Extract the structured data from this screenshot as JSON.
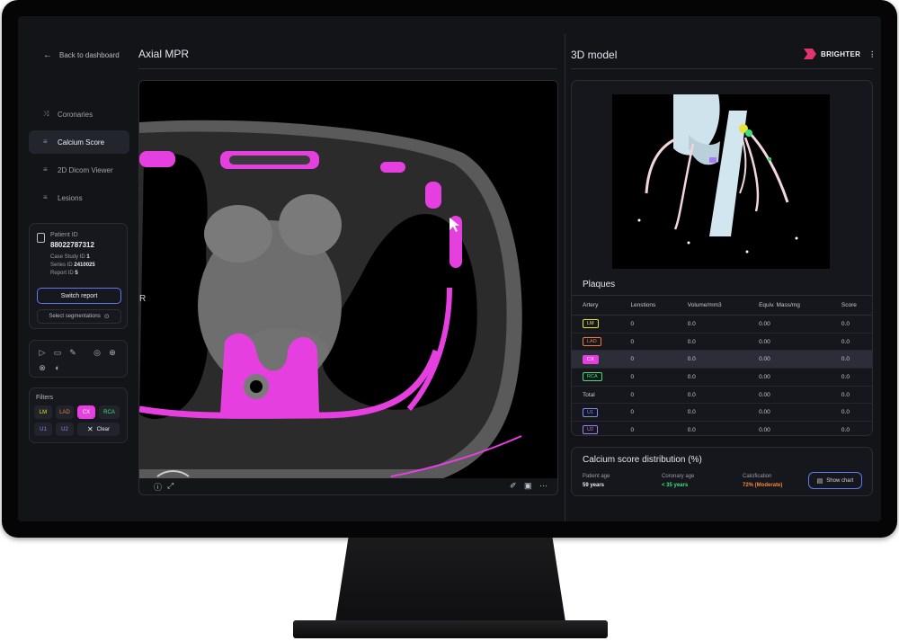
{
  "sidebar": {
    "back_label": "Back to dashboard",
    "nav": [
      {
        "label": "Coronaries",
        "icon": "shuffle-icon"
      },
      {
        "label": "Calcium Score",
        "icon": "sliders-icon"
      },
      {
        "label": "2D Dicom Viewer",
        "icon": "sliders-icon"
      },
      {
        "label": "Lesions",
        "icon": "sliders-icon"
      }
    ],
    "patient": {
      "id_label": "Patient ID",
      "id_value": "88022787312",
      "case_label": "Case Study ID",
      "case_value": "1",
      "series_label": "Series ID",
      "series_value": "2410025",
      "report_label": "Report ID",
      "report_value": "5",
      "switch_label": "Switch report",
      "select_label": "Select segmentations"
    },
    "filters": {
      "title": "Filters",
      "chips": [
        "LM",
        "LAD",
        "CX",
        "RCA",
        "U1",
        "U2"
      ],
      "clear_label": "Clear"
    }
  },
  "axial": {
    "title": "Axial MPR",
    "marker": "R"
  },
  "model": {
    "title": "3D model",
    "brand": "BRIGHTER",
    "plaques_title": "Plaques",
    "columns": [
      "Artery",
      "Lenstions",
      "Volume/mm3",
      "Equiv. Mass/mg",
      "Score"
    ],
    "rows": [
      {
        "artery": "LM",
        "lesions": "0",
        "volume": "0.0",
        "mass": "0.00",
        "score": "0.0"
      },
      {
        "artery": "LAD",
        "lesions": "0",
        "volume": "0.0",
        "mass": "0.00",
        "score": "0.0"
      },
      {
        "artery": "CX",
        "lesions": "0",
        "volume": "0.0",
        "mass": "0.00",
        "score": "0.0"
      },
      {
        "artery": "RCA",
        "lesions": "0",
        "volume": "0.0",
        "mass": "0.00",
        "score": "0.0"
      },
      {
        "artery": "Total",
        "lesions": "0",
        "volume": "0.0",
        "mass": "0.00",
        "score": "0.0"
      },
      {
        "artery": "U1",
        "lesions": "0",
        "volume": "0.0",
        "mass": "0.00",
        "score": "0.0"
      },
      {
        "artery": "U2",
        "lesions": "0",
        "volume": "0.0",
        "mass": "0.00",
        "score": "0.0"
      }
    ]
  },
  "calcium": {
    "title": "Calcium score distribution (%)",
    "patient_age_label": "Patient age",
    "patient_age_value": "59 years",
    "coronary_age_label": "Coronary age",
    "coronary_age_value": "< 35 years",
    "calcification_label": "Calcification",
    "calcification_value": "72% (Moderate)",
    "show_chart_label": "Show chart"
  },
  "colors": {
    "accent": "#5b7bf0",
    "calcium_overlay": "#e63fe0",
    "LM": "#e6e23a",
    "LAD": "#f07a3a",
    "CX": "#e63fe0",
    "RCA": "#3ee07a",
    "U1": "#7a8cf5",
    "U2": "#a77af5",
    "coronary_age": "#3ee07a",
    "calcification": "#f0883a"
  }
}
